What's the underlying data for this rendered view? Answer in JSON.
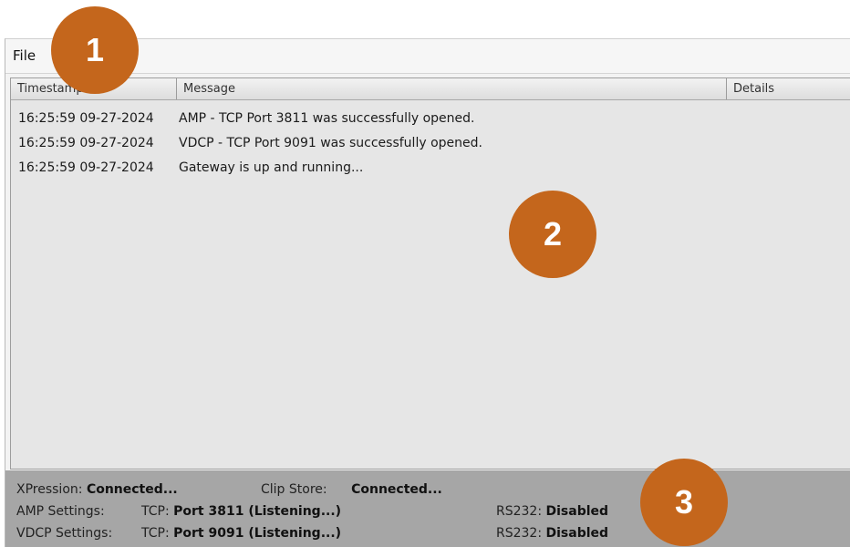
{
  "menu": {
    "file": "File"
  },
  "columns": [
    "Timestamp",
    "Message",
    "Details"
  ],
  "log": [
    {
      "timestamp": "16:25:59  09-27-2024",
      "message": "AMP - TCP Port 3811 was successfully opened.",
      "details": ""
    },
    {
      "timestamp": "16:25:59  09-27-2024",
      "message": "VDCP - TCP Port 9091 was successfully opened.",
      "details": ""
    },
    {
      "timestamp": "16:25:59  09-27-2024",
      "message": "Gateway is up and running...",
      "details": ""
    }
  ],
  "status": {
    "xpression_label": "XPression:",
    "xpression_value": "Connected...",
    "clipstore_label": "Clip Store:",
    "clipstore_value": "Connected...",
    "amp_label": "AMP Settings:",
    "amp_tcp_label": "TCP:",
    "amp_tcp_value": "Port 3811 (Listening...)",
    "amp_rs232_label": "RS232:",
    "amp_rs232_value": "Disabled",
    "vdcp_label": "VDCP Settings:",
    "vdcp_tcp_label": "TCP:",
    "vdcp_tcp_value": "Port 9091 (Listening...)",
    "vdcp_rs232_label": "RS232:",
    "vdcp_rs232_value": "Disabled"
  },
  "callouts": [
    "1",
    "2",
    "3"
  ],
  "colors": {
    "callout": "#c4661c",
    "log_background": "#e6e6e6",
    "status_background": "#a6a6a6"
  }
}
